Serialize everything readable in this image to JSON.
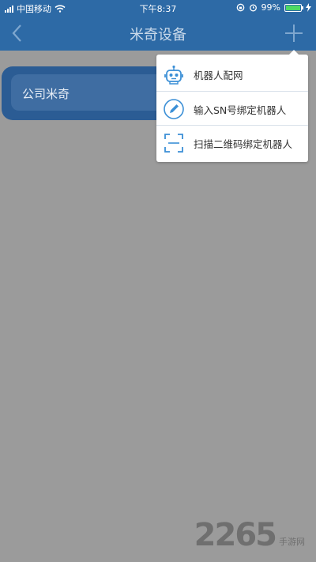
{
  "status_bar": {
    "carrier": "中国移动",
    "time": "下午8:37",
    "battery_percent": "99%",
    "battery_level": 0.99
  },
  "nav": {
    "title": "米奇设备",
    "back_icon": "chevron-left-icon",
    "add_icon": "plus-icon"
  },
  "device_list": [
    {
      "name": "公司米奇"
    }
  ],
  "menu": {
    "items": [
      {
        "label": "机器人配网",
        "icon": "robot-icon"
      },
      {
        "label": "输入SN号绑定机器人",
        "icon": "pencil-icon"
      },
      {
        "label": "扫描二维码绑定机器人",
        "icon": "scan-icon"
      }
    ]
  },
  "watermark": {
    "number": "2265",
    "sub": "手游网"
  },
  "colors": {
    "nav_bg": "#2d6aa6",
    "overlay_bg": "#9b9b9b",
    "icon_blue": "#3b8fd6",
    "battery_green": "#4cd964"
  }
}
